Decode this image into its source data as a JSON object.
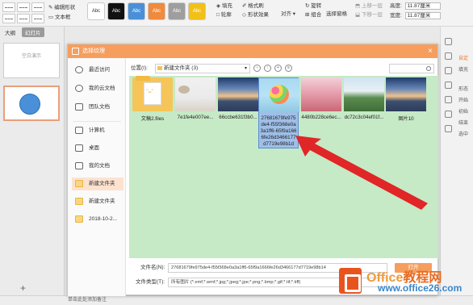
{
  "ribbon": {
    "edit_shape": "编辑形状",
    "text_box": "文本框",
    "shape_styles": [
      "Abc",
      "Abc",
      "Abc",
      "Abc",
      "Abc",
      "Abc"
    ],
    "fill": "填充",
    "outline": "轮廓",
    "format_brush": "格式刷",
    "shape_effect": "形状效果",
    "align": "对齐",
    "rotate": "旋转",
    "group": "组合",
    "selection_pane": "选择窗格",
    "bring_forward": "上移一层",
    "send_backward": "下移一层",
    "height_label": "高度",
    "height_value": "11.87厘米",
    "width_label": "宽度",
    "width_value": "11.87厘米"
  },
  "left_panel": {
    "outline_tab": "大纲",
    "slides_tab": "幻灯片",
    "thumb1_text": "空白演示"
  },
  "dialog": {
    "title": "选择纹理",
    "nav": [
      {
        "label": "最近访问",
        "icon": "clock-icon"
      },
      {
        "label": "我的云文档",
        "icon": "cloud-icon"
      },
      {
        "label": "团队文档",
        "icon": "team-icon"
      },
      {
        "label": "计算机",
        "icon": "computer-icon"
      },
      {
        "label": "桌面",
        "icon": "desktop-icon"
      },
      {
        "label": "我的文档",
        "icon": "document-icon"
      },
      {
        "label": "新建文件夹",
        "icon": "folder-icon"
      },
      {
        "label": "新建文件夹",
        "icon": "folder-icon"
      },
      {
        "label": "2018-10-2...",
        "icon": "folder-icon"
      }
    ],
    "location_label": "位置(I):",
    "location_value": "新建文件夹 (3)",
    "files": [
      {
        "name": "文稿2.files",
        "kind": "folder"
      },
      {
        "name": "7e1fe4e007ee...",
        "kind": "image"
      },
      {
        "name": "66ccbe631f3b0...",
        "kind": "image"
      },
      {
        "name": "27681679fe975de4-f55f368e0a3a1ff6-65f9a1666fe26d3466177d7719e98b1d",
        "kind": "image"
      },
      {
        "name": "4480b228ce6ec...",
        "kind": "image"
      },
      {
        "name": "dc72c3c04ef01f...",
        "kind": "image"
      },
      {
        "name": "图片10",
        "kind": "image"
      }
    ],
    "filename_label": "文件名(N):",
    "filename_value": "27681679fe975de4-f55f368e0a3a1ff6-65f9a1666fe26d3466177d7719e98b14",
    "filetype_label": "文件类型(T):",
    "filetype_value": "所有图片 (*.emf;*.wmf;*.jpg;*.jpeg;*.jpe;*.png;*.bmp;*.gif;*.tif;*.tiff)",
    "open_button": "打开"
  },
  "right_bar": {
    "labels": [
      "自定",
      "填充",
      "形态",
      "开始",
      "初始",
      "结束"
    ],
    "hint": "选中"
  },
  "status": {
    "notes_hint": "单击此处添加备注"
  },
  "watermark": {
    "brand": "Office",
    "brand_cn": "教程网",
    "url": "www.office26.com"
  },
  "colors": {
    "accent": "#f59e5e",
    "file_area_bg": "#c6e9c6",
    "selection": "#9fbfe8",
    "arrow": "#e02626"
  }
}
